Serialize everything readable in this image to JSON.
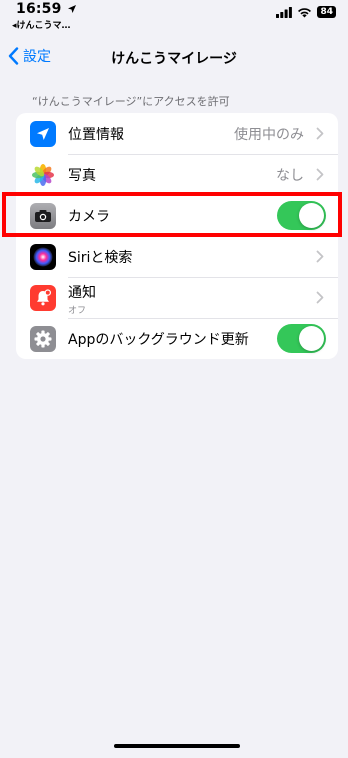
{
  "status_bar": {
    "time": "16:59",
    "back_app": "◂けんこうマ…",
    "battery": "84"
  },
  "nav": {
    "back_label": "設定",
    "title": "けんこうマイレージ"
  },
  "section_header": "“けんこうマイレージ”にアクセスを許可",
  "rows": [
    {
      "icon": "location-arrow-icon",
      "label": "位置情報",
      "value": "使用中のみ",
      "control": "chevron",
      "color": "#007aff"
    },
    {
      "icon": "photos-icon",
      "label": "写真",
      "value": "なし",
      "control": "chevron"
    },
    {
      "icon": "camera-icon",
      "label": "カメラ",
      "control": "toggle",
      "toggle_on": true,
      "color": "#8e8e93"
    },
    {
      "icon": "siri-icon",
      "label": "Siriと検索",
      "control": "chevron"
    },
    {
      "icon": "notification-bell-icon",
      "label": "通知",
      "sublabel": "オフ",
      "control": "chevron",
      "color": "#ff3b30"
    },
    {
      "icon": "gear-icon",
      "label": "Appのバックグラウンド更新",
      "control": "toggle",
      "toggle_on": true,
      "color": "#8e8e93"
    }
  ],
  "colors": {
    "accent": "#007aff",
    "toggle_on": "#34c759",
    "highlight": "#ff0000",
    "background": "#f2f2f7"
  }
}
